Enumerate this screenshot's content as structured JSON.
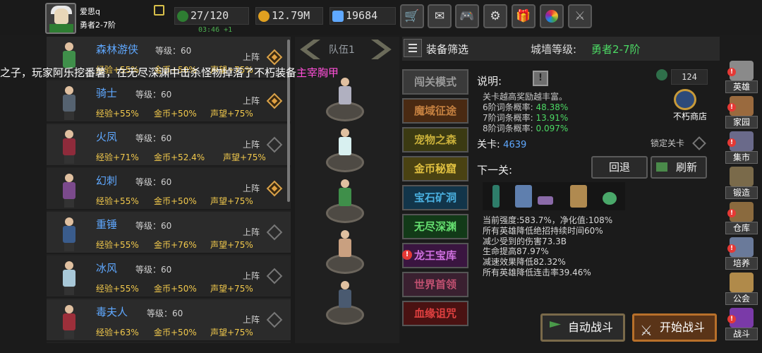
{
  "player": {
    "name": "爱思q",
    "rank": "勇者2-7阶"
  },
  "resources": {
    "stamina": "27/120",
    "stamina_timer": "03:46 +1",
    "gold": "12.79M",
    "gems": "19684"
  },
  "toolbar_icons": [
    "cart-icon",
    "mail-icon",
    "gamepad-icon",
    "gear-icon",
    "gift-icon",
    "wheel-icon",
    "wing-icon"
  ],
  "marquee": {
    "text": "之子，玩家阿乐挖番薯，在无尽深渊中击杀怪物掉落了不朽装备",
    "highlight": "主宰胸甲"
  },
  "heroes": [
    {
      "name": "森林游侠",
      "level": "等级：60",
      "deploy": "上阵",
      "active": true,
      "b1": "经验+55%",
      "b2": "金币+50%",
      "b3": "声望+75%",
      "color": "#3f8f4a"
    },
    {
      "name": "骑士",
      "level": "等级：60",
      "deploy": "上阵",
      "active": true,
      "b1": "经验+55%",
      "b2": "金币+50%",
      "b3": "声望+75%",
      "color": "#556270"
    },
    {
      "name": "火凤",
      "level": "等级：60",
      "deploy": "上阵",
      "active": false,
      "b1": "经验+71%",
      "b2": "金币+52.4%",
      "b3": "声望+75%",
      "color": "#8e2b3b"
    },
    {
      "name": "幻刺",
      "level": "等级：60",
      "deploy": "上阵",
      "active": true,
      "b1": "经验+55%",
      "b2": "金币+50%",
      "b3": "声望+75%",
      "color": "#7b4a8c"
    },
    {
      "name": "重锤",
      "level": "等级：60",
      "deploy": "上阵",
      "active": false,
      "b1": "经验+55%",
      "b2": "金币+76%",
      "b3": "声望+75%",
      "color": "#3a5c8c"
    },
    {
      "name": "冰风",
      "level": "等级：60",
      "deploy": "上阵",
      "active": false,
      "b1": "经验+55%",
      "b2": "金币+50%",
      "b3": "声望+75%",
      "color": "#a8c8d8"
    },
    {
      "name": "毒夫人",
      "level": "等级：60",
      "deploy": "上阵",
      "active": false,
      "b1": "经验+63%",
      "b2": "金币+50%",
      "b3": "声望+75%",
      "color": "#9c2f3a"
    }
  ],
  "team": {
    "label": "队伍1",
    "members": [
      "#b0b0c0",
      "#d8f0f0",
      "#3f8f4a",
      "#c9a080",
      "#4a5a70"
    ]
  },
  "panel": {
    "filter_label": "装备筛选",
    "wall_label": "城墙等级:",
    "wall_value": "勇者2-7阶"
  },
  "modes": [
    {
      "label": "闯关模式",
      "bg": "#3a3a3a",
      "fg": "#9a9a9a",
      "alert": false
    },
    {
      "label": "魔域征途",
      "bg": "#4a2a12",
      "fg": "#c48040",
      "alert": false
    },
    {
      "label": "宠物之森",
      "bg": "#3b3a12",
      "fg": "#c9b03a",
      "alert": false
    },
    {
      "label": "金币秘窟",
      "bg": "#4a4212",
      "fg": "#e0c040",
      "alert": false
    },
    {
      "label": "宝石矿洞",
      "bg": "#12354a",
      "fg": "#4ab0e0",
      "alert": false
    },
    {
      "label": "无尽深渊",
      "bg": "#123a18",
      "fg": "#66e070",
      "alert": false
    },
    {
      "label": "龙王宝库",
      "bg": "#3a1540",
      "fg": "#d070e0",
      "alert": true
    },
    {
      "label": "世界首领",
      "bg": "#3a2030",
      "fg": "#c05070",
      "alert": false
    },
    {
      "label": "血缘诅咒",
      "bg": "#4a1212",
      "fg": "#e04040",
      "alert": false
    }
  ],
  "details": {
    "desc_label": "说明:",
    "info_glyph": "!",
    "count": "124",
    "shop_label": "不朽商店",
    "rate_title": "关卡越高奖励越丰富。",
    "rate6_label": "6阶词条概率:",
    "rate6_value": "48.38%",
    "rate7_label": "7阶词条概率:",
    "rate7_value": "13.91%",
    "rate8_label": "8阶词条概率:",
    "rate8_value": "0.097%",
    "level_label": "关卡:",
    "level_value": "4639",
    "lock_label": "锁定关卡",
    "next_label": "下一关:",
    "back_button": "回退",
    "refresh_button": "刷新",
    "stats": [
      "当前强度:583.7%，净化值:108%",
      "所有英雄降低绝招持续时间60%",
      "减少受到的伤害73.3B",
      "生命提高87.97%",
      "减速效果降低82.32%",
      "所有英雄降低连击率39.46%"
    ],
    "auto_battle": "自动战斗",
    "start_battle": "开始战斗"
  },
  "sidebar": [
    {
      "label": "英雄",
      "alert": true
    },
    {
      "label": "家园",
      "alert": true
    },
    {
      "label": "集市",
      "alert": true
    },
    {
      "label": "锻造",
      "alert": false
    },
    {
      "label": "仓库",
      "alert": true
    },
    {
      "label": "培养",
      "alert": true
    },
    {
      "label": "公会",
      "alert": false
    },
    {
      "label": "战斗",
      "alert": true
    }
  ]
}
